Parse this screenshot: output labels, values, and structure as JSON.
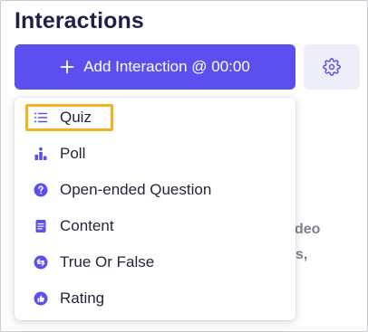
{
  "panel": {
    "title": "Interactions"
  },
  "toolbar": {
    "add_label": "Add Interaction @ 00:00"
  },
  "background": {
    "fragment_1": "deo",
    "fragment_2": "s,"
  },
  "colors": {
    "accent": "#5b4ff0",
    "highlight": "#f2b21c",
    "icon": "#5b4ff0"
  },
  "menu": {
    "items": [
      {
        "label": "Quiz",
        "icon": "list-icon",
        "highlighted": true
      },
      {
        "label": "Poll",
        "icon": "poll-icon"
      },
      {
        "label": "Open-ended Question",
        "icon": "question-icon"
      },
      {
        "label": "Content",
        "icon": "document-icon"
      },
      {
        "label": "True Or False",
        "icon": "true-false-icon"
      },
      {
        "label": "Rating",
        "icon": "thumbs-up-icon"
      }
    ]
  }
}
